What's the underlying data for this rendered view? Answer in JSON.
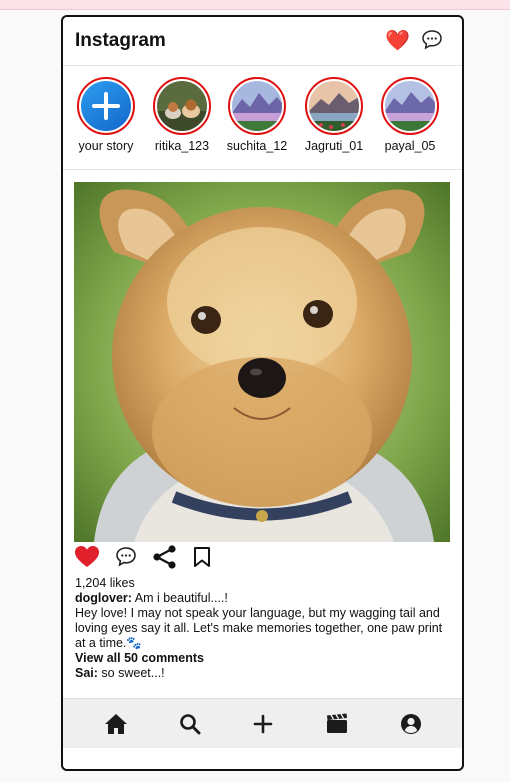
{
  "app": {
    "title": "Instagram"
  },
  "header": {
    "like_icon": "heart-icon",
    "message_icon": "speech-bubble-icon"
  },
  "stories": [
    {
      "username": "your story",
      "type": "add"
    },
    {
      "username": "ritika_123",
      "type": "image"
    },
    {
      "username": "suchita_12",
      "type": "image"
    },
    {
      "username": "Jagruti_01",
      "type": "image"
    },
    {
      "username": "payal_05",
      "type": "image"
    }
  ],
  "post": {
    "likes": "1,204 likes",
    "author": "doglover:",
    "caption_title": "Am i beautiful....!",
    "caption_body": "Hey love! I may not speak your language, but my wagging tail and loving eyes say it all. Let's make memories together, one paw print at a time.🐾",
    "view_all": "View all 50 comments",
    "comment_author": "Sai:",
    "comment_text": "so sweet...!"
  },
  "nav": [
    "home-icon",
    "search-icon",
    "add-icon",
    "reels-icon",
    "profile-icon"
  ],
  "colors": {
    "story_ring": "#e01010",
    "add_story": "#1a7fe0",
    "like": "#e0202b"
  }
}
